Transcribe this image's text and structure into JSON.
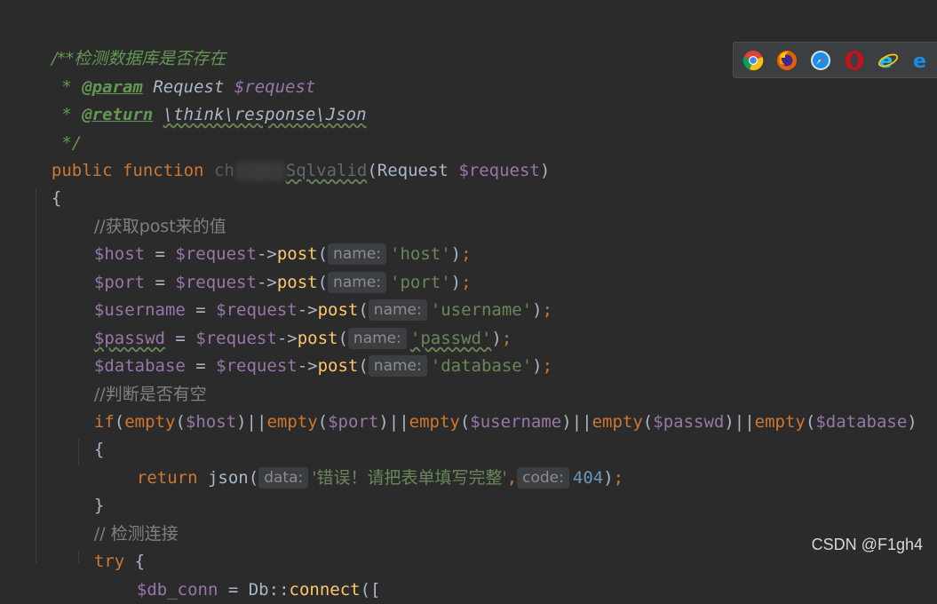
{
  "editor": {
    "doc_open": "/**检测数据库是否存在",
    "doc_star": " * ",
    "param_tag": "@param",
    "param_type": "Request",
    "param_var": "$request",
    "return_tag": "@return",
    "return_type": "\\think\\response\\Json",
    "doc_close": " */",
    "kw_public": "public",
    "kw_function": "function",
    "fn_name_prefix": "ch",
    "fn_name_suffix": "Sqlvalid",
    "fn_params_open": "(Request ",
    "fn_params_var": "$request",
    "fn_params_close": ")",
    "brace_open": "{",
    "brace_close": "}",
    "comment_post": "//获取post来的值",
    "assign_host_var": "$host",
    "assign_port_var": "$port",
    "assign_username_var": "$username",
    "assign_passwd_var": "$passwd",
    "assign_database_var": "$database",
    "equals": " = ",
    "request_var": "$request",
    "arrow": "->",
    "post_fn": "post",
    "paren_open": "(",
    "paren_close": ")",
    "semicolon": ";",
    "hint_name": "name:",
    "str_host": "'host'",
    "str_port": "'port'",
    "str_username": "'username'",
    "str_passwd": "'passwd'",
    "str_database": "'database'",
    "comment_empty": "//判断是否有空",
    "kw_if": "if",
    "fn_empty": "empty",
    "op_or": "||",
    "kw_return": "return",
    "fn_json": "json",
    "hint_data": "data:",
    "str_error": "'错误！请把表单填写完整'",
    "comma": ",",
    "hint_code": "code:",
    "num_404": "404",
    "comment_check": "// 检测连接",
    "kw_try": "try",
    "try_brace": " {",
    "db_conn_var": "$db_conn",
    "db_class": "Db",
    "static_op": "::",
    "fn_connect": "connect",
    "bracket_open": "(["
  },
  "browser_icons": [
    "chrome-icon",
    "firefox-icon",
    "safari-icon",
    "opera-icon",
    "ie-icon",
    "edge-icon"
  ],
  "watermark": "CSDN @F1gh4"
}
